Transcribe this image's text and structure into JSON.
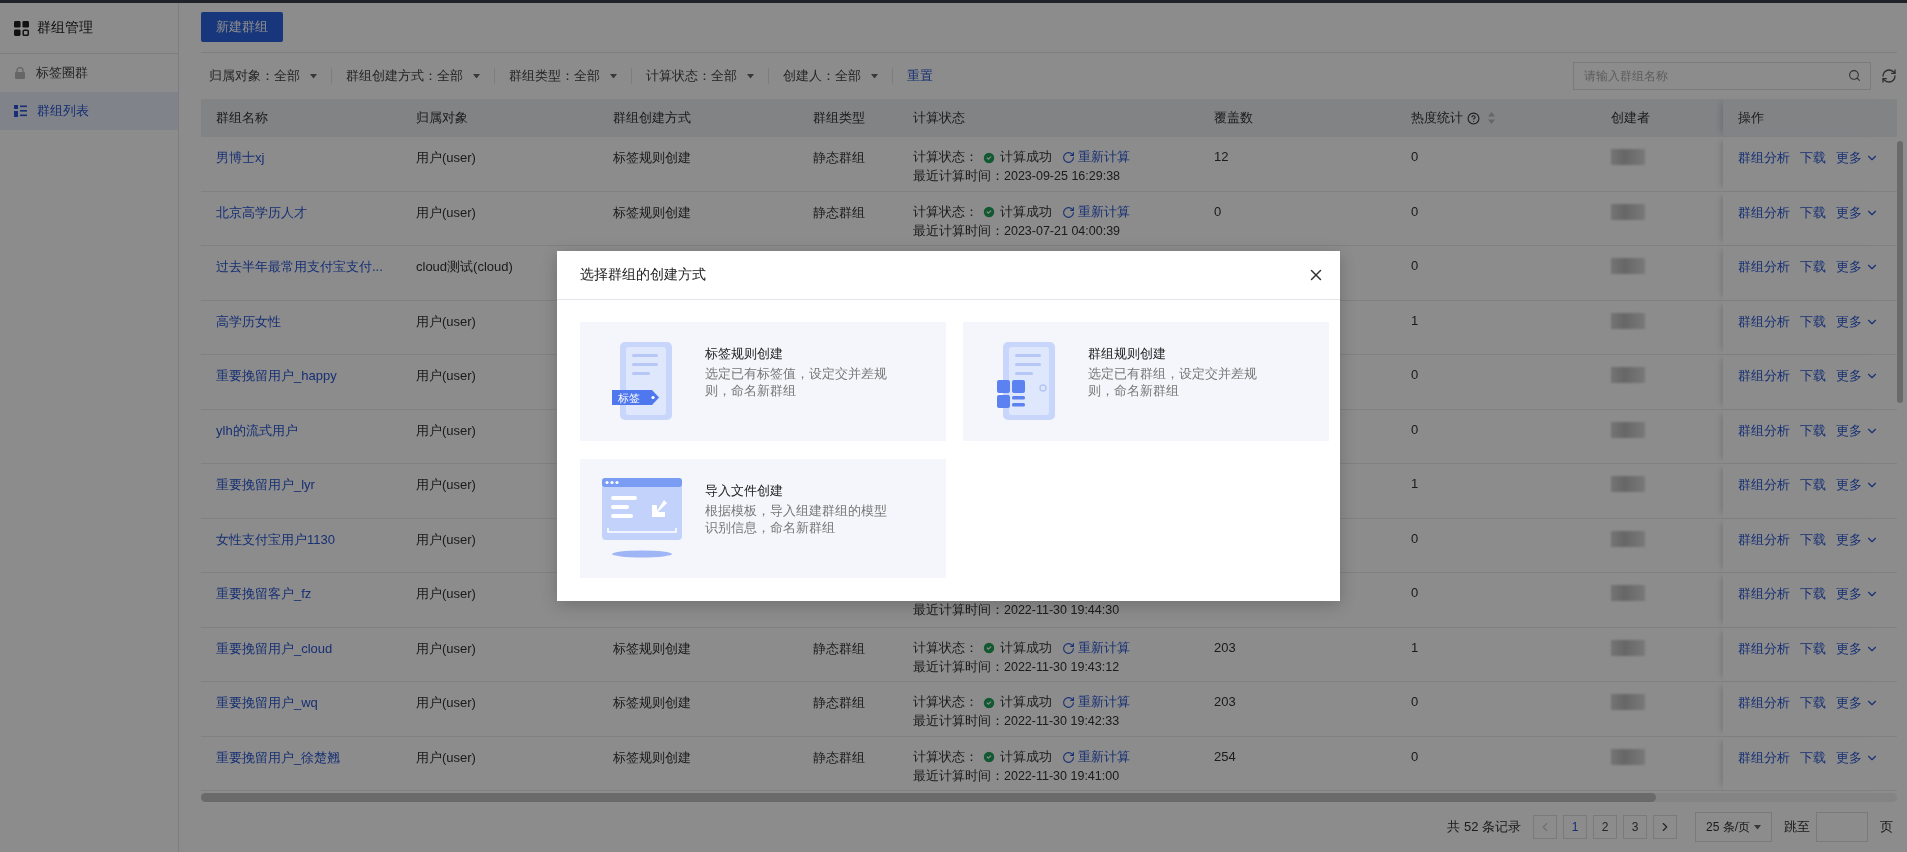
{
  "sidebar": {
    "title": "群组管理",
    "items": [
      {
        "label": "标签圈群",
        "kind": "bag",
        "selected": false
      },
      {
        "label": "群组列表",
        "kind": "list",
        "selected": true
      }
    ]
  },
  "toolbar": {
    "new_button": "新建群组"
  },
  "filters": {
    "items": [
      "归属对象：全部",
      "群组创建方式：全部",
      "群组类型：全部",
      "计算状态：全部",
      "创建人：全部"
    ],
    "reset": "重置",
    "search": {
      "placeholder": "请输入群组名称"
    }
  },
  "table": {
    "columns": [
      {
        "label": "群组名称"
      },
      {
        "label": "归属对象"
      },
      {
        "label": "群组创建方式"
      },
      {
        "label": "群组类型"
      },
      {
        "label": "计算状态"
      },
      {
        "label": "覆盖数"
      },
      {
        "label": "热度统计",
        "help": true,
        "sortable": true
      },
      {
        "label": "创建者"
      },
      {
        "label": "操作"
      }
    ],
    "rows": [
      {
        "name": "男博士xj",
        "target": "用户(user)",
        "method": "标签规则创建",
        "type": "静态群组",
        "calc": {
          "status_label": "计算状态：",
          "status": "计算成功",
          "action": "重新计算",
          "time": "最近计算时间：2023-09-25 16:29:38"
        },
        "coverage": "12",
        "heat": "0",
        "creator_redacted": true,
        "actions": [
          "群组分析",
          "下载",
          "更多"
        ]
      },
      {
        "name": "北京高学历人才",
        "target": "用户(user)",
        "method": "标签规则创建",
        "type": "静态群组",
        "calc": {
          "status_label": "计算状态：",
          "status": "计算成功",
          "action": "重新计算",
          "time": "最近计算时间：2023-07-21 04:00:39"
        },
        "coverage": "0",
        "heat": "0",
        "creator_redacted": true,
        "actions": [
          "群组分析",
          "下载",
          "更多"
        ]
      },
      {
        "name": "过去半年最常用支付宝支付...",
        "target": "cloud测试(cloud)",
        "heat": "0",
        "creator_redacted": true,
        "actions": [
          "群组分析",
          "下载",
          "更多"
        ]
      },
      {
        "name": "高学历女性",
        "target": "用户(user)",
        "heat": "1",
        "creator_redacted": true,
        "actions": [
          "群组分析",
          "下载",
          "更多"
        ]
      },
      {
        "name": "重要挽留用户_happy",
        "target": "用户(user)",
        "heat": "0",
        "creator_redacted": true,
        "actions": [
          "群组分析",
          "下载",
          "更多"
        ]
      },
      {
        "name": "ylh的流式用户",
        "target": "用户(user)",
        "heat": "0",
        "creator_redacted": true,
        "actions": [
          "群组分析",
          "下载",
          "更多"
        ]
      },
      {
        "name": "重要挽留用户_lyr",
        "target": "用户(user)",
        "heat": "1",
        "creator_redacted": true,
        "actions": [
          "群组分析",
          "下载",
          "更多"
        ]
      },
      {
        "name": "女性支付宝用户1130",
        "target": "用户(user)",
        "heat": "0",
        "creator_redacted": true,
        "actions": [
          "群组分析",
          "下载",
          "更多"
        ]
      },
      {
        "name": "重要挽留客户_fz",
        "target": "用户(user)",
        "calc": {
          "time": "最近计算时间：2022-11-30 19:44:30"
        },
        "heat": "0",
        "creator_redacted": true,
        "actions": [
          "群组分析",
          "下载",
          "更多"
        ]
      },
      {
        "name": "重要挽留用户_cloud",
        "target": "用户(user)",
        "method": "标签规则创建",
        "type": "静态群组",
        "calc": {
          "status_label": "计算状态：",
          "status": "计算成功",
          "action": "重新计算",
          "time": "最近计算时间：2022-11-30 19:43:12"
        },
        "coverage": "203",
        "heat": "1",
        "creator_redacted": true,
        "actions": [
          "群组分析",
          "下载",
          "更多"
        ]
      },
      {
        "name": "重要挽留用户_wq",
        "target": "用户(user)",
        "method": "标签规则创建",
        "type": "静态群组",
        "calc": {
          "status_label": "计算状态：",
          "status": "计算成功",
          "action": "重新计算",
          "time": "最近计算时间：2022-11-30 19:42:33"
        },
        "coverage": "203",
        "heat": "0",
        "creator_redacted": true,
        "actions": [
          "群组分析",
          "下载",
          "更多"
        ]
      },
      {
        "name": "重要挽留用户_徐楚翘",
        "target": "用户(user)",
        "method": "标签规则创建",
        "type": "静态群组",
        "calc": {
          "status_label": "计算状态：",
          "status": "计算成功",
          "action": "重新计算",
          "time": "最近计算时间：2022-11-30 19:41:00"
        },
        "coverage": "254",
        "heat": "0",
        "creator_redacted": true,
        "actions": [
          "群组分析",
          "下载",
          "更多"
        ]
      }
    ]
  },
  "pagination": {
    "total": "共 52 条记录",
    "prev_disabled": true,
    "next_disabled": false,
    "pages": [
      {
        "label": "1",
        "selected": true
      },
      {
        "label": "2",
        "selected": false
      },
      {
        "label": "3",
        "selected": false
      }
    ],
    "page_size": "25 条/页",
    "jump_label": "跳至",
    "page_unit": "页"
  },
  "modal": {
    "title": "选择群组的创建方式",
    "options": [
      {
        "kind": "tag",
        "title": "标签规则创建",
        "description": "选定已有标签值，设定交并差规则，命名新群组",
        "icon_label": "标签"
      },
      {
        "kind": "group",
        "title": "群组规则创建",
        "description": "选定已有群组，设定交并差规则，命名新群组"
      },
      {
        "kind": "import",
        "title": "导入文件创建",
        "description": "根据模板，导入组建群组的模型识别信息，命名新群组"
      }
    ]
  }
}
